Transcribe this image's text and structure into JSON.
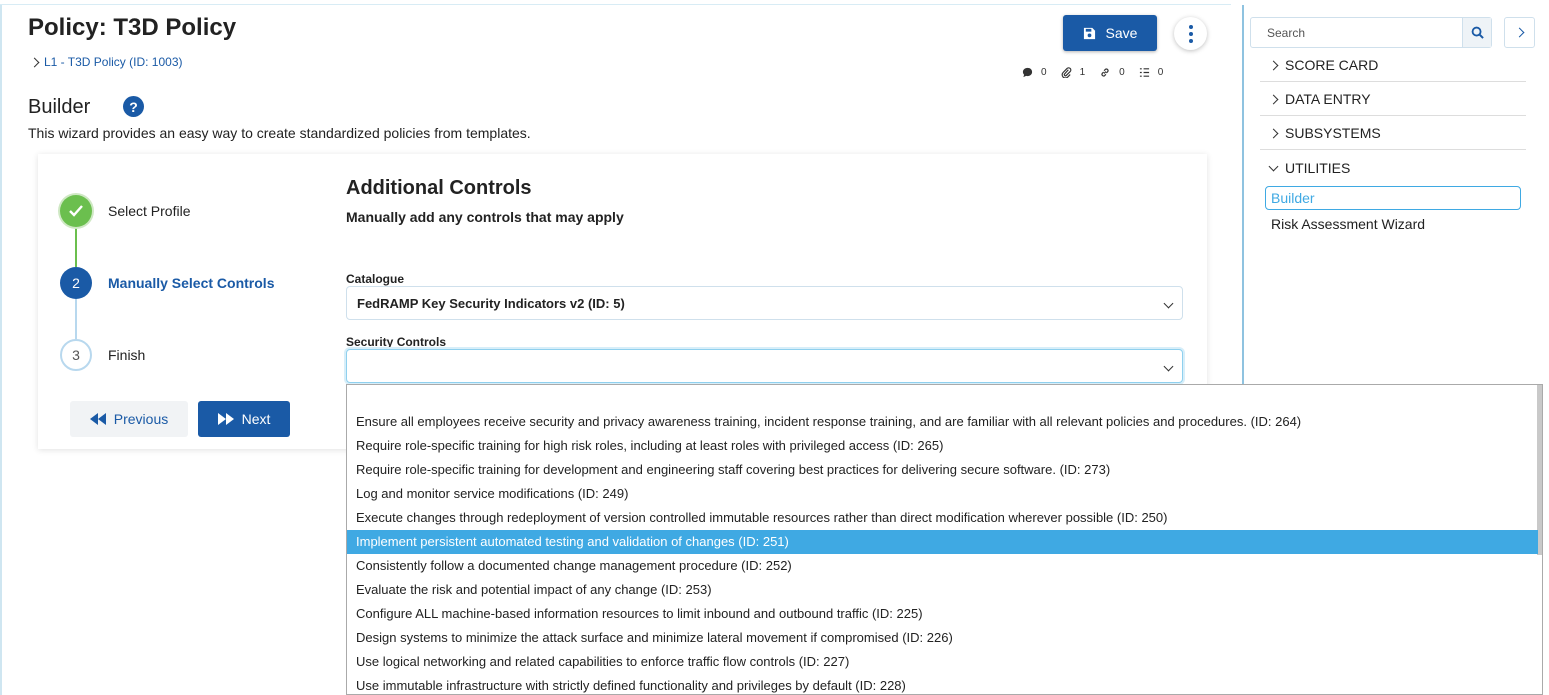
{
  "header": {
    "title": "Policy: T3D Policy",
    "breadcrumb": "L1 - T3D Policy (ID: 1003)",
    "save_label": "Save",
    "counters": {
      "comments": "0",
      "attachments": "1",
      "links": "0",
      "tasks": "0"
    }
  },
  "builder": {
    "heading": "Builder",
    "help_icon": "?",
    "description": "This wizard provides an easy way to create standardized policies from templates."
  },
  "wizard": {
    "steps": [
      {
        "number": "1",
        "label": "Select Profile",
        "status": "complete"
      },
      {
        "number": "2",
        "label": "Manually Select Controls",
        "status": "active"
      },
      {
        "number": "3",
        "label": "Finish",
        "status": "pending"
      }
    ],
    "previous_label": "Previous",
    "next_label": "Next"
  },
  "form": {
    "heading": "Additional Controls",
    "subheading": "Manually add any controls that may apply",
    "catalogue_label": "Catalogue",
    "catalogue_value": "FedRAMP Key Security Indicators v2 (ID: 5)",
    "controls_label": "Security Controls",
    "controls_value": ""
  },
  "dropdown": {
    "selected_index": 5,
    "options": [
      "Ensure all employees receive security and privacy awareness training, incident response training, and are familiar with all relevant policies and procedures. (ID: 264)",
      "Require role-specific training for high risk roles, including at least roles with privileged access (ID: 265)",
      "Require role-specific training for development and engineering staff covering best practices for delivering secure software. (ID: 273)",
      "Log and monitor service modifications (ID: 249)",
      "Execute changes through redeployment of version controlled immutable resources rather than direct modification wherever possible (ID: 250)",
      "Implement persistent automated testing and validation of changes (ID: 251)",
      "Consistently follow a documented change management procedure (ID: 252)",
      "Evaluate the risk and potential impact of any change (ID: 253)",
      "Configure ALL machine-based information resources to limit inbound and outbound traffic (ID: 225)",
      "Design systems to minimize the attack surface and minimize lateral movement if compromised (ID: 226)",
      "Use logical networking and related capabilities to enforce traffic flow controls (ID: 227)",
      "Use immutable infrastructure with strictly defined functionality and privileges by default (ID: 228)"
    ]
  },
  "sidebar": {
    "search_placeholder": "Search",
    "sections": [
      {
        "label": "SCORE CARD",
        "expanded": false
      },
      {
        "label": "DATA ENTRY",
        "expanded": false
      },
      {
        "label": "SUBSYSTEMS",
        "expanded": false
      },
      {
        "label": "UTILITIES",
        "expanded": true
      }
    ],
    "utilities_items": [
      "Builder",
      "Risk Assessment Wizard"
    ],
    "active_item": "Builder"
  },
  "colors": {
    "primary": "#1a5aa6",
    "success": "#6bbf4e",
    "highlight": "#3fa9e3"
  }
}
